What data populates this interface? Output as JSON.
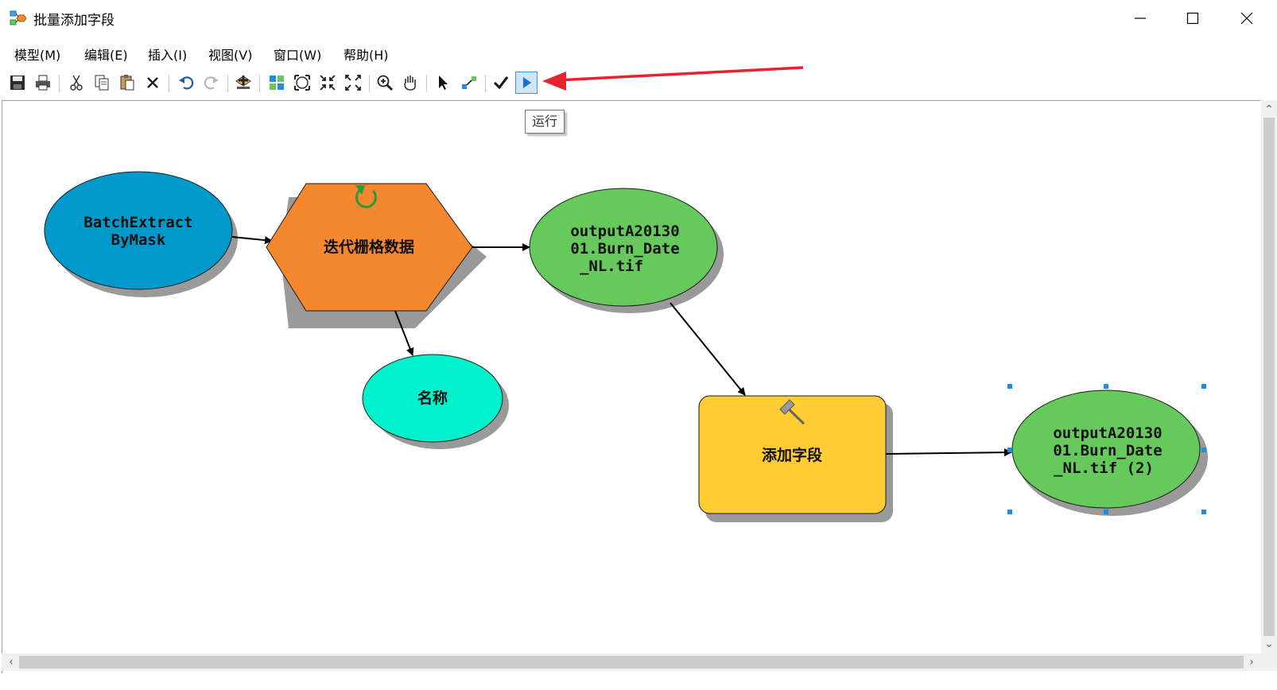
{
  "window": {
    "title": "批量添加字段",
    "minimize_glyph": "—",
    "maximize_glyph": "□",
    "close_glyph": "✕"
  },
  "menu": [
    {
      "label": "模型(M)"
    },
    {
      "label": "编辑(E)"
    },
    {
      "label": "插入(I)"
    },
    {
      "label": "视图(V)"
    },
    {
      "label": "窗口(W)"
    },
    {
      "label": "帮助(H)"
    }
  ],
  "toolbar": {
    "tooltip": "运行",
    "icons": [
      "save-icon",
      "print-icon",
      "cut-icon",
      "copy-icon",
      "paste-icon",
      "delete-icon",
      "undo-icon",
      "redo-icon",
      "add-data-icon",
      "auto-layout-icon",
      "full-extent-icon",
      "fixed-zoom-in-icon",
      "fixed-zoom-out-icon",
      "zoom-in-icon",
      "pan-icon",
      "select-icon",
      "connect-icon",
      "validate-icon",
      "run-icon"
    ]
  },
  "nodes": {
    "input": {
      "line1": "BatchExtract",
      "line2": "ByMask",
      "color": "#0099cc"
    },
    "iterator": {
      "label": "迭代栅格数据",
      "color": "#f5872f"
    },
    "output1": {
      "line1": "outputA20130",
      "line2": "01.Burn_Date",
      "line3": "_NL.tif",
      "color": "#66c95c"
    },
    "name": {
      "label": "名称",
      "color": "#00f2cc"
    },
    "tool": {
      "label": "添加字段",
      "color": "#ffcc33"
    },
    "output2": {
      "line1": "outputA20130",
      "line2": "01.Burn_Date",
      "line3": "_NL.tif (2)",
      "color": "#66c95c"
    }
  },
  "colors": {
    "arrow_annotation": "#e8232f",
    "selection_handle": "#1a8fe3"
  }
}
